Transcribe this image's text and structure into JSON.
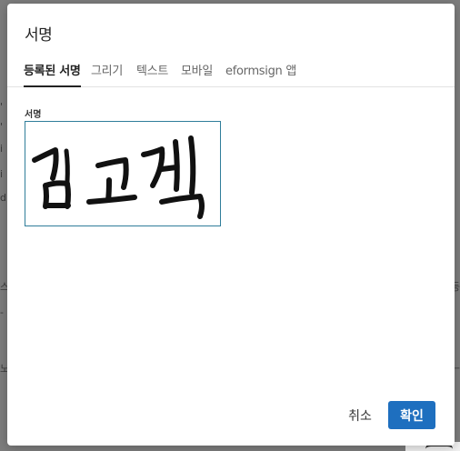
{
  "modal": {
    "title": "서명",
    "tabs": [
      {
        "label": "등록된 서명",
        "active": true
      },
      {
        "label": "그리기",
        "active": false
      },
      {
        "label": "텍스트",
        "active": false
      },
      {
        "label": "모바일",
        "active": false
      },
      {
        "label": "eformsign 앱",
        "active": false
      }
    ],
    "field_label": "서명",
    "signature_text": "김고객",
    "cancel_label": "취소",
    "confirm_label": "확인"
  },
  "background": {
    "left_fragments": [
      "'",
      "'",
      "i",
      "i",
      "d",
      "스",
      "-",
      "노"
    ],
    "right_fragments": [
      "등",
      "ㅡ"
    ]
  },
  "colors": {
    "accent": "#1e6fbf",
    "signature_border": "#2f7d9a",
    "overlay": "#7d7d7d"
  }
}
